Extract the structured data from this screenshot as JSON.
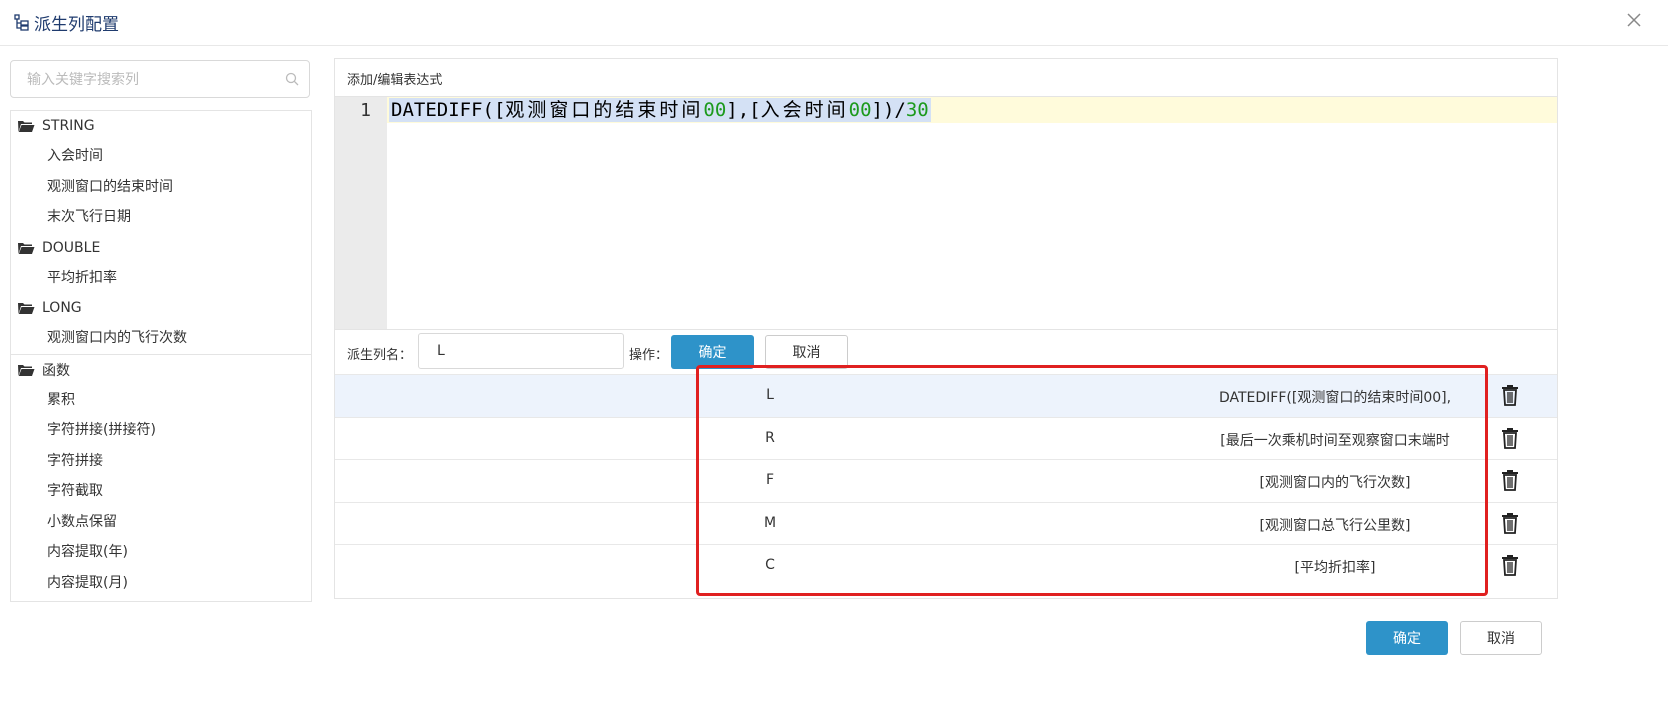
{
  "dialog": {
    "title": "派生列配置",
    "title_icon": "tree-structure-icon",
    "close_icon": "close-icon"
  },
  "sidebar": {
    "search_placeholder": "输入关键字搜索列",
    "search_icon": "search-icon",
    "groups": [
      {
        "label": "STRING",
        "items": [
          "入会时间",
          "观测窗口的结束时间",
          "末次飞行日期"
        ]
      },
      {
        "label": "DOUBLE",
        "items": [
          "平均折扣率"
        ]
      },
      {
        "label": "LONG",
        "items": [
          "观测窗口内的飞行次数"
        ]
      },
      {
        "label": "函数",
        "items": [
          "累积",
          "字符拼接(拼接符)",
          "字符拼接",
          "字符截取",
          "小数点保留",
          "内容提取(年)",
          "内容提取(月)"
        ]
      }
    ]
  },
  "editor": {
    "section_label": "添加/编辑表达式",
    "line_number": "1",
    "code_tokens": [
      "DATEDIFF([",
      "观测窗口的结束时间",
      "00",
      "],[",
      "入会时间",
      "00",
      "])/",
      "30"
    ]
  },
  "form": {
    "name_label": "派生列名：",
    "name_value": "L",
    "op_label": "操作：",
    "confirm": "确定",
    "cancel": "取消"
  },
  "table": {
    "rows": [
      {
        "name": "L",
        "expr": "DATEDIFF([观测窗口的结束时间00],",
        "selected": true
      },
      {
        "name": "R",
        "expr": "[最后一次乘机时间至观察窗口末端时",
        "selected": false
      },
      {
        "name": "F",
        "expr": "[观测窗口内的飞行次数]",
        "selected": false
      },
      {
        "name": "M",
        "expr": "[观测窗口总飞行公里数]",
        "selected": false
      },
      {
        "name": "C",
        "expr": "[平均折扣率]",
        "selected": false
      }
    ],
    "delete_icon": "trash-icon"
  },
  "footer": {
    "confirm": "确定",
    "cancel": "取消"
  },
  "colors": {
    "primary": "#2e93c9",
    "highlight": "#e02020",
    "selected_row": "#edf3fc",
    "code_number": "#1d9a1d",
    "code_selection": "#d4e1f5",
    "code_line": "#fffbdb"
  }
}
